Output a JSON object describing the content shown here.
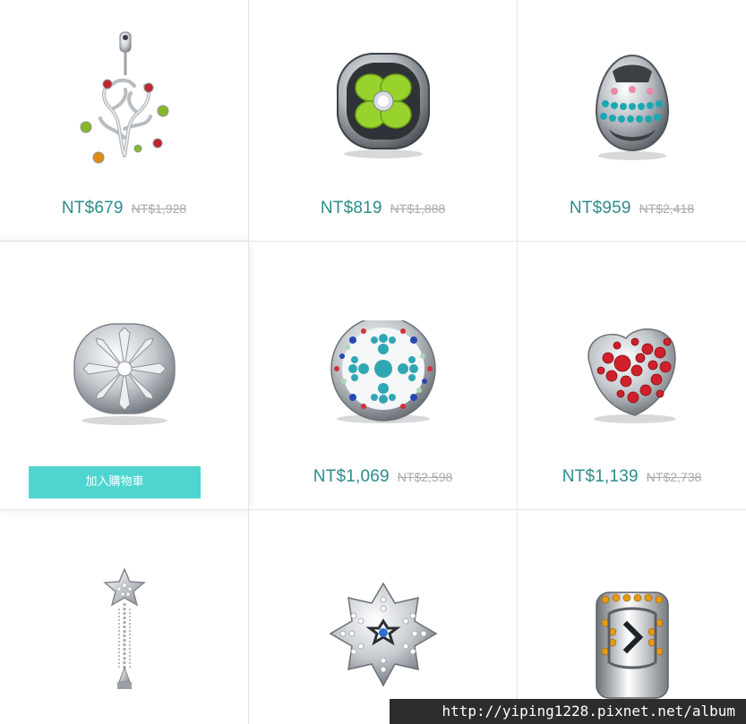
{
  "products": [
    {
      "name": "tree-of-life-pendant-charm",
      "price": "NT$679",
      "original_price": "NT$1,928"
    },
    {
      "name": "four-leaf-clover-charm",
      "price": "NT$819",
      "original_price": "NT$1,888"
    },
    {
      "name": "easter-egg-charm",
      "price": "NT$959",
      "original_price": "NT$2,418"
    },
    {
      "name": "crystal-flower-charm",
      "cart_button_label": "加入購物車"
    },
    {
      "name": "blue-cross-crystal-charm",
      "price": "NT$1,069",
      "original_price": "NT$2,598"
    },
    {
      "name": "red-heart-crystal-charm",
      "price": "NT$1,139",
      "original_price": "NT$2,738"
    },
    {
      "name": "star-wand-dangle-charm"
    },
    {
      "name": "snowflake-charm"
    },
    {
      "name": "orange-crystal-arrow-charm"
    }
  ],
  "colors": {
    "price": "#2b8c8a",
    "original_price": "#a9a9a9",
    "cart_button": "#4fd5cf",
    "watermark_bg": "#2d2d2d"
  },
  "watermark": "http://yiping1228.pixnet.net/album"
}
